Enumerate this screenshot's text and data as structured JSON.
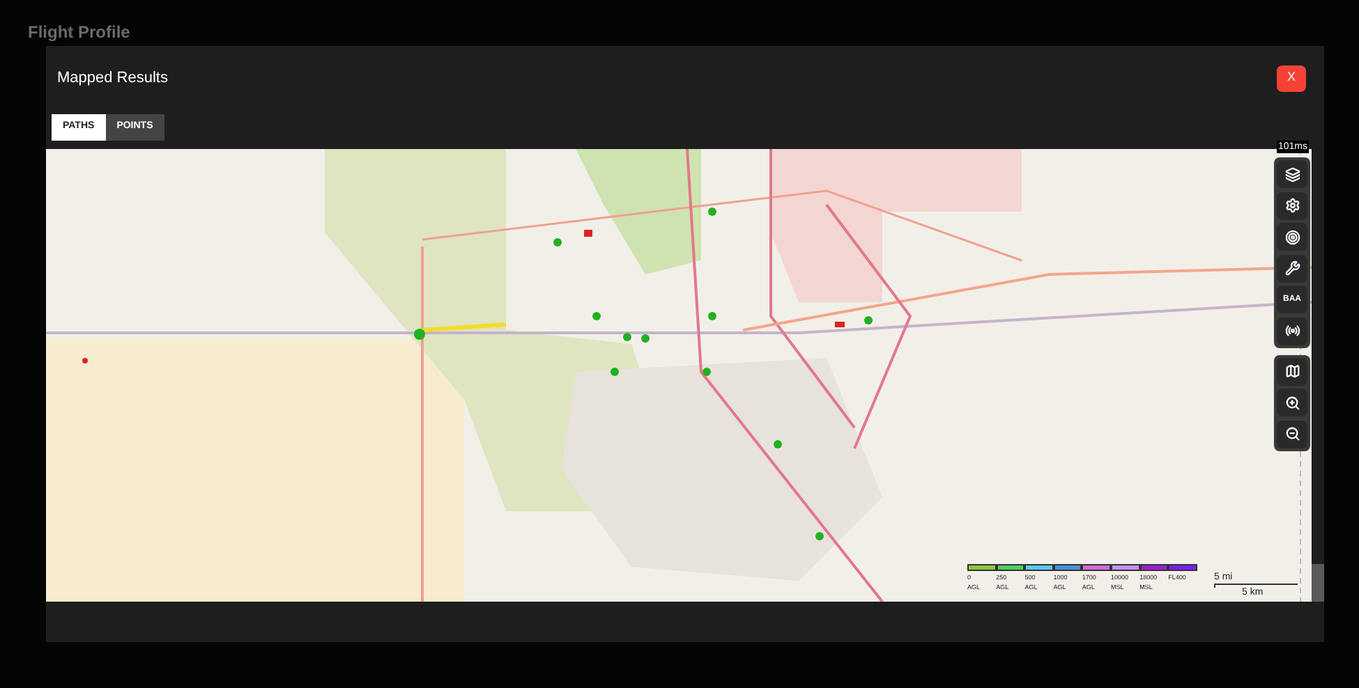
{
  "background": {
    "title": "Flight Profile"
  },
  "dialog": {
    "title": "Mapped Results",
    "close_label": "X"
  },
  "tabs": [
    {
      "label": "PATHS",
      "selected": true
    },
    {
      "label": "POINTS",
      "selected": false
    }
  ],
  "map": {
    "latency": "101ms",
    "tool_groups": [
      [
        {
          "kind": "layers"
        },
        {
          "kind": "settings"
        },
        {
          "kind": "target"
        },
        {
          "kind": "tools"
        },
        {
          "kind": "text",
          "label": "BAA"
        },
        {
          "kind": "broadcast"
        }
      ],
      [
        {
          "kind": "map"
        },
        {
          "kind": "zoom-in"
        },
        {
          "kind": "zoom-out"
        }
      ]
    ],
    "legend": [
      {
        "value": "0",
        "ref": "AGL",
        "color": "#8dc63f"
      },
      {
        "value": "250",
        "ref": "AGL",
        "color": "#4cd15a"
      },
      {
        "value": "500",
        "ref": "AGL",
        "color": "#5bc8f0"
      },
      {
        "value": "1000",
        "ref": "AGL",
        "color": "#4a90d9"
      },
      {
        "value": "1700",
        "ref": "AGL",
        "color": "#d36ad6"
      },
      {
        "value": "10000",
        "ref": "MSL",
        "color": "#c58ef0"
      },
      {
        "value": "18000",
        "ref": "MSL",
        "color": "#9b1fd1"
      },
      {
        "value": "FL400",
        "color": "#7b1ff0"
      }
    ],
    "scale": {
      "miles": "5 mi",
      "km": "5 km"
    }
  }
}
